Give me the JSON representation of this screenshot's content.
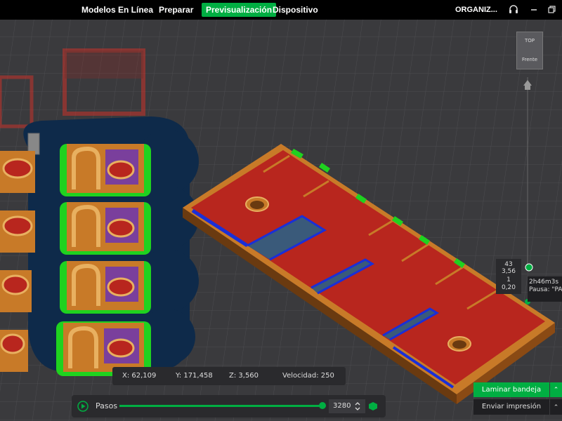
{
  "topbar": {
    "tabs": [
      {
        "label": "Modelos En Línea",
        "active": false
      },
      {
        "label": "Preparar",
        "active": false
      },
      {
        "label": "Previsualización",
        "active": true
      },
      {
        "label": "Dispositivo",
        "active": false
      }
    ],
    "org_label": "ORGANIZ...",
    "icons": [
      "headset-icon",
      "minimize-icon",
      "restore-icon"
    ]
  },
  "viewcube": {
    "top_label": "TOP",
    "front_label": "Frente"
  },
  "coords": {
    "x": "X: 62,109",
    "y": "Y: 171,458",
    "z": "Z: 3,560",
    "speed": "Velocidad: 250"
  },
  "steps": {
    "label": "Pasos",
    "value": "3280",
    "progress": 0.99
  },
  "layer_slider": {
    "top_layer": "43",
    "top_height": "3,56",
    "bottom_layer": "1",
    "bottom_height": "0,20"
  },
  "tooltip": {
    "time": "2h46m3s",
    "pause": "Pausa: \"PAU"
  },
  "buttons": {
    "slice": "Laminar bandeja",
    "print": "Enviar impresión"
  },
  "colors": {
    "accent": "#00ae42",
    "wall": "#b8261e",
    "infill": "#7a3f9c",
    "support": "#1fd21f",
    "bridge": "#1a2fd8",
    "brim": "#0e2a4a"
  }
}
